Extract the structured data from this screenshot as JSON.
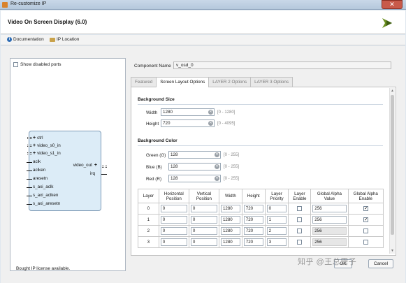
{
  "window": {
    "title": "Re-customize IP",
    "close_label": "✕"
  },
  "header": {
    "ip_title": "Video On Screen Display (6.0)"
  },
  "links": {
    "documentation": "Documentation",
    "ip_location": "IP Location"
  },
  "left_panel": {
    "show_disabled_ports": "Show disabled ports",
    "ports_left": [
      "ctrl",
      "video_s0_in",
      "video_s1_in",
      "aclk",
      "aclken",
      "aresetn",
      "s_axi_aclk",
      "s_axi_aclken",
      "s_axi_aresetn"
    ],
    "ports_right": [
      "video_out",
      "irq"
    ]
  },
  "component": {
    "label": "Component Name",
    "value": "v_osd_0"
  },
  "tabs": [
    "Featured",
    "Screen Layout Options",
    "LAYER 2 Options",
    "LAYER 3 Options"
  ],
  "background_size": {
    "title": "Background Size",
    "width_label": "Width",
    "width_value": "1280",
    "width_range": "[0 - 1280]",
    "height_label": "Height",
    "height_value": "720",
    "height_range": "[0 - 4095]"
  },
  "background_color": {
    "title": "Background Color",
    "green_label": "Green (G)",
    "green_value": "128",
    "green_range": "[0 - 255]",
    "blue_label": "Blue (B)",
    "blue_value": "128",
    "blue_range": "[0 - 255]",
    "red_label": "Red (R)",
    "red_value": "128",
    "red_range": "[0 - 255]"
  },
  "layer_table": {
    "headers": [
      "Layer",
      "Horizontal Position",
      "Vertical Position",
      "Width",
      "Height",
      "Layer Priority",
      "Layer Enable",
      "Global Alpha Value",
      "Global Alpha Enable"
    ],
    "rows": [
      {
        "layer": "0",
        "h": "0",
        "v": "0",
        "w": "1280",
        "ht": "720",
        "pri": "0",
        "enable": false,
        "alpha": "256",
        "alpha_enable": true
      },
      {
        "layer": "1",
        "h": "0",
        "v": "0",
        "w": "1280",
        "ht": "720",
        "pri": "1",
        "enable": false,
        "alpha": "256",
        "alpha_enable": true
      },
      {
        "layer": "2",
        "h": "0",
        "v": "0",
        "w": "1280",
        "ht": "720",
        "pri": "2",
        "enable": false,
        "alpha": "256",
        "alpha_enable": false
      },
      {
        "layer": "3",
        "h": "0",
        "v": "0",
        "w": "1280",
        "ht": "720",
        "pri": "3",
        "enable": false,
        "alpha": "256",
        "alpha_enable": false
      }
    ]
  },
  "footer": {
    "status": "Bought IP license available.",
    "ok": "OK",
    "cancel": "Cancel"
  },
  "watermark": "知乎 @王总需子",
  "colors": {
    "accent": "#2f6db5",
    "ip_block": "#dcecf7"
  }
}
